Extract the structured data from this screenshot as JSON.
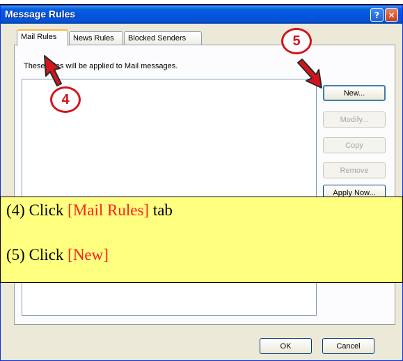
{
  "window": {
    "title": "Message Rules",
    "help_glyph": "?",
    "close_glyph": "✕"
  },
  "tabs": [
    {
      "label": "Mail Rules",
      "active": true
    },
    {
      "label": "News Rules",
      "active": false
    },
    {
      "label": "Blocked Senders",
      "active": false
    }
  ],
  "description": "These rules will be applied to Mail messages.",
  "buttons": {
    "new": "New...",
    "modify": "Modify...",
    "copy": "Copy",
    "remove": "Remove",
    "apply_now": "Apply Now...",
    "ok": "OK",
    "cancel": "Cancel"
  },
  "callouts": {
    "step4": "4",
    "step5": "5"
  },
  "instructions": {
    "line1_prefix": "(4) Click ",
    "line1_highlight": "[Mail Rules]",
    "line1_suffix": " tab",
    "line2_prefix": "(5) Click ",
    "line2_highlight": "[New]"
  },
  "colors": {
    "titlebar": "#0054e3",
    "callout": "#d4141c",
    "note_bg": "#ffff80",
    "highlight": "#ff2020"
  },
  "icons": [
    "help-icon",
    "close-icon",
    "arrow-pointer-icon"
  ]
}
